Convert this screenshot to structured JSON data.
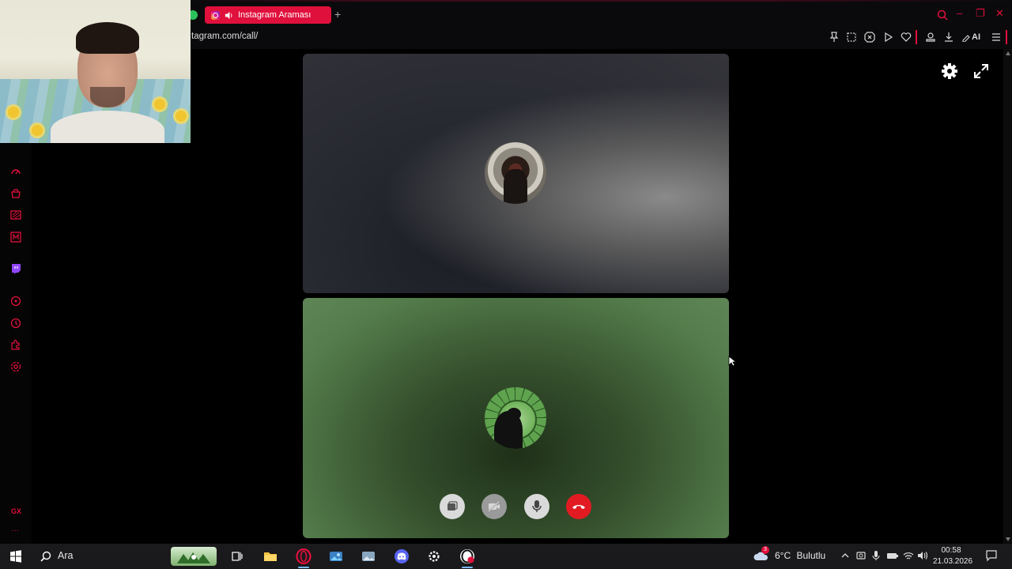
{
  "browser": {
    "tab_title": "Instagram Araması",
    "new_tab_symbol": "+",
    "url": "tagram.com/call/",
    "toolbar_ai_label": "AI",
    "window_controls": {
      "minimize": "–",
      "restore": "❐",
      "close": "✕"
    }
  },
  "sidebar": {
    "items": [
      "speed-dial",
      "marketplace",
      "news",
      "mail",
      "twitch",
      "player",
      "history",
      "extensions",
      "settings"
    ],
    "gx_label": "GX",
    "more_label": "···"
  },
  "call": {
    "participants": [
      {
        "name": "participant-1",
        "tile_color": "#2a2b30"
      },
      {
        "name": "participant-2",
        "tile_color": "#3f5e37"
      }
    ],
    "controls": [
      "screen-share",
      "camera-off",
      "microphone",
      "end-call"
    ],
    "end_call_color": "#e21b22"
  },
  "taskbar": {
    "search_placeholder": "Ara",
    "weather": {
      "temp": "6°C",
      "condition": "Bulutlu",
      "badge": "3"
    },
    "clock": {
      "time": "00:58",
      "date": "21.03.2026"
    }
  },
  "colors": {
    "accent": "#e0103c",
    "taskbar_bg": "#1a1a1c"
  }
}
